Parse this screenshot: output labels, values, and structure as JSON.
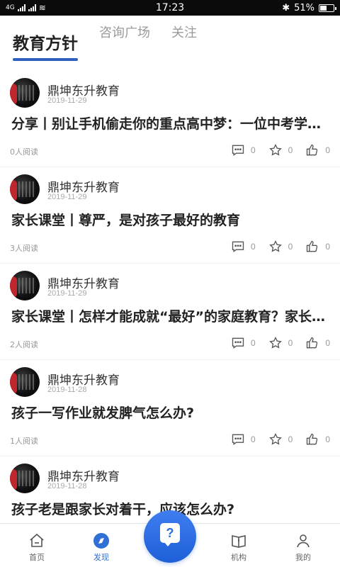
{
  "status_bar": {
    "left": "4G",
    "time": "17:23",
    "battery": "51%"
  },
  "tabs": [
    {
      "label": "教育方针",
      "active": true
    },
    {
      "label": "咨询广场",
      "active": false
    },
    {
      "label": "关注",
      "active": false
    }
  ],
  "posts": [
    {
      "author": "鼎坤东升教育",
      "date": "2019-11-29",
      "title": "分享丨别让手机偷走你的重点高中梦：一位中考学霸的真心话",
      "reads": "0人阅读",
      "comments": "0",
      "favorites": "0",
      "likes": "0"
    },
    {
      "author": "鼎坤东升教育",
      "date": "2019-11-29",
      "title": "家长课堂丨尊严，是对孩子最好的教育",
      "reads": "3人阅读",
      "comments": "0",
      "favorites": "0",
      "likes": "0"
    },
    {
      "author": "鼎坤东升教育",
      "date": "2019-11-29",
      "title": "家长课堂丨怎样才能成就“最好”的家庭教育？家长必读",
      "reads": "2人阅读",
      "comments": "0",
      "favorites": "0",
      "likes": "0"
    },
    {
      "author": "鼎坤东升教育",
      "date": "2019-11-28",
      "title": "孩子一写作业就发脾气怎么办?",
      "reads": "1人阅读",
      "comments": "0",
      "favorites": "0",
      "likes": "0"
    },
    {
      "author": "鼎坤东升教育",
      "date": "2019-11-28",
      "title": "孩子老是跟家长对着干，应该怎么办?",
      "reads": "",
      "comments": "",
      "favorites": "",
      "likes": ""
    }
  ],
  "bottom_nav": {
    "home": "首页",
    "discover": "发现",
    "ask_icon": "question-bubble-icon",
    "institution": "机构",
    "mine": "我的"
  },
  "colors": {
    "accent": "#2f6fd6",
    "tab_underline": "#2f5fbf",
    "fab": "#1e5fd8"
  }
}
